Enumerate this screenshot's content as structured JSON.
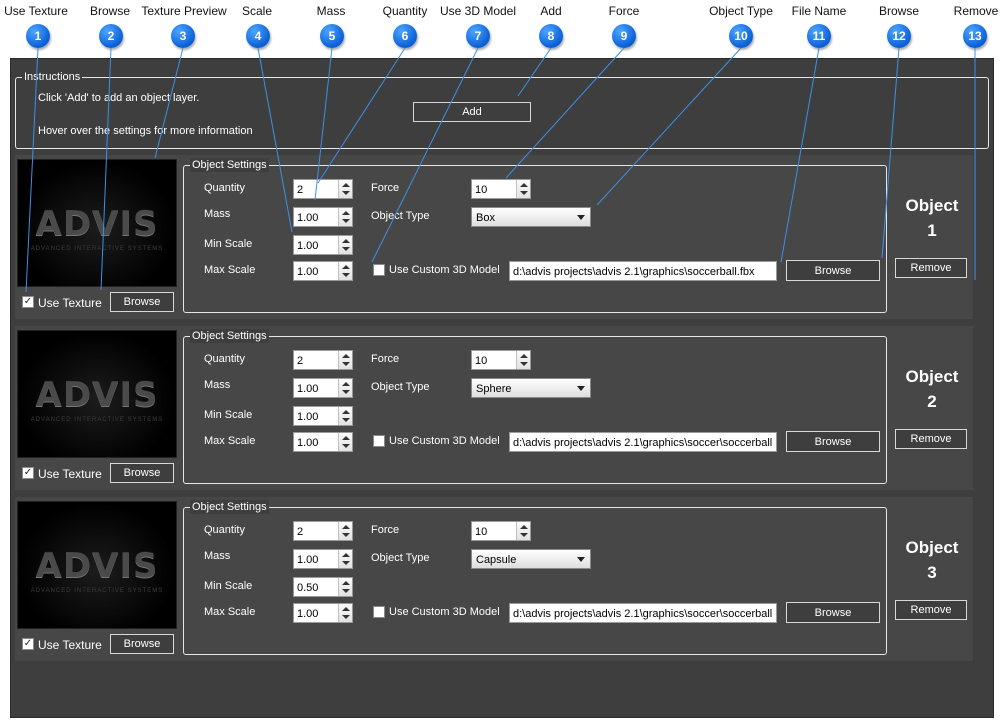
{
  "callouts": [
    {
      "number": "1",
      "label": "Use Texture"
    },
    {
      "number": "2",
      "label": "Browse"
    },
    {
      "number": "3",
      "label": "Texture Preview"
    },
    {
      "number": "4",
      "label": "Scale"
    },
    {
      "number": "5",
      "label": "Mass"
    },
    {
      "number": "6",
      "label": "Quantity"
    },
    {
      "number": "7",
      "label": "Use 3D Model"
    },
    {
      "number": "8",
      "label": "Add"
    },
    {
      "number": "9",
      "label": "Force"
    },
    {
      "number": "10",
      "label": "Object Type"
    },
    {
      "number": "11",
      "label": "File Name"
    },
    {
      "number": "12",
      "label": "Browse"
    },
    {
      "number": "13",
      "label": "Remove"
    }
  ],
  "instructions": {
    "legend": "Instructions",
    "line1": "Click 'Add' to add an object layer.",
    "line2": "Hover over the settings for more information",
    "add_label": "Add"
  },
  "labels": {
    "object_settings": "Object Settings",
    "quantity": "Quantity",
    "mass": "Mass",
    "min_scale": "Min Scale",
    "max_scale": "Max Scale",
    "force": "Force",
    "object_type": "Object Type",
    "use_custom_model": "Use Custom 3D Model",
    "use_texture": "Use Texture",
    "browse": "Browse",
    "remove": "Remove",
    "object": "Object"
  },
  "preview": {
    "logo": "ADVIS",
    "tagline": "ADVANCED INTERACTIVE SYSTEMS"
  },
  "objects": [
    {
      "number": "1",
      "quantity": "2",
      "mass": "1.00",
      "min_scale": "1.00",
      "max_scale": "1.00",
      "force": "10",
      "object_type": "Box",
      "use_custom_model": false,
      "file_name": "d:\\advis projects\\advis 2.1\\graphics\\soccerball.fbx",
      "use_texture": true
    },
    {
      "number": "2",
      "quantity": "2",
      "mass": "1.00",
      "min_scale": "1.00",
      "max_scale": "1.00",
      "force": "10",
      "object_type": "Sphere",
      "use_custom_model": false,
      "file_name": "d:\\advis projects\\advis 2.1\\graphics\\soccer\\soccerball",
      "use_texture": true
    },
    {
      "number": "3",
      "quantity": "2",
      "mass": "1.00",
      "min_scale": "0.50",
      "max_scale": "1.00",
      "force": "10",
      "object_type": "Capsule",
      "use_custom_model": false,
      "file_name": "d:\\advis projects\\advis 2.1\\graphics\\soccer\\soccerball",
      "use_texture": true
    }
  ]
}
